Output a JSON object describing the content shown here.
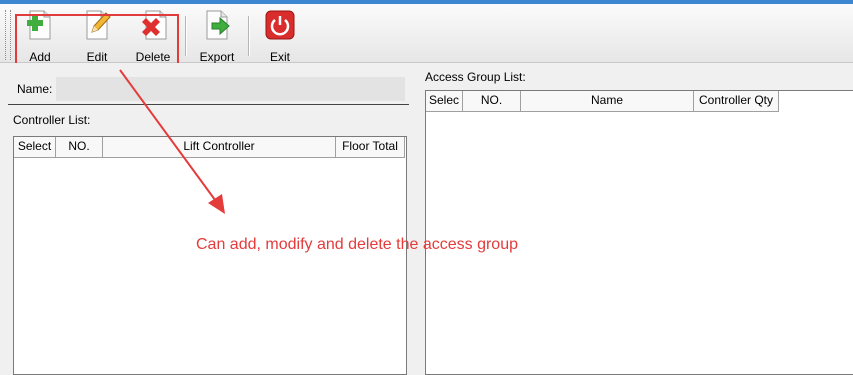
{
  "toolbar": {
    "add_label": "Add",
    "edit_label": "Edit",
    "delete_label": "Delete",
    "export_label": "Export",
    "exit_label": "Exit"
  },
  "form": {
    "name_label": "Name:",
    "name_value": ""
  },
  "controller_list": {
    "title": "Controller List:",
    "columns": [
      "Select",
      "NO.",
      "Lift Controller",
      "Floor Total"
    ]
  },
  "access_group_list": {
    "title": "Access Group List:",
    "columns": [
      "Selec",
      "NO.",
      "Name",
      "Controller Qty"
    ]
  },
  "annotation": {
    "text": "Can add, modify and delete the access group",
    "color": "#e43b3b"
  },
  "colors": {
    "highlight": "#e23b3b",
    "title_bar": "#3d87d2"
  },
  "icons": {
    "add": "add-document-icon",
    "edit": "edit-pencil-icon",
    "delete": "delete-x-icon",
    "export": "export-arrow-icon",
    "exit": "power-icon"
  }
}
